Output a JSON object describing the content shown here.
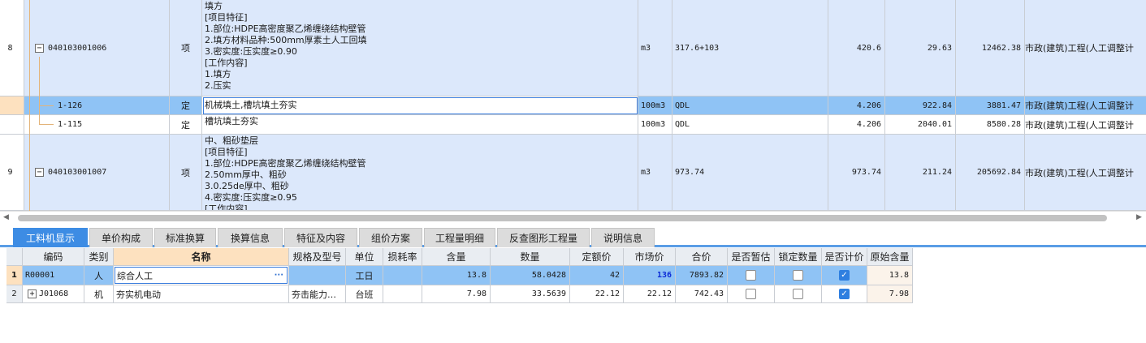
{
  "upper_rows": [
    {
      "row_no": "8",
      "code": "040103001006",
      "kind": "项",
      "description": "填方\n[项目特征]\n1.部位:HDPE高密度聚乙烯缠绕结构壁管\n2.填方材料品种:500mm厚素土人工回填\n3.密实度:压实度≥0.90\n[工作内容]\n1.填方\n2.压实",
      "unit": "m3",
      "expr": "317.6+103",
      "qty": "420.6",
      "price": "29.63",
      "total": "12462.38",
      "specialty": "市政(建筑)工程(人工调整计"
    },
    {
      "row_no": "",
      "code": "1-126",
      "kind": "定",
      "description": "机械填土,槽坑填土夯实",
      "unit": "100m3",
      "expr": "QDL",
      "qty": "4.206",
      "price": "922.84",
      "total": "3881.47",
      "specialty": "市政(建筑)工程(人工调整计"
    },
    {
      "row_no": "",
      "code": "1-115",
      "kind": "定",
      "description": "槽坑填土夯实",
      "unit": "100m3",
      "expr": "QDL",
      "qty": "4.206",
      "price": "2040.01",
      "total": "8580.28",
      "specialty": "市政(建筑)工程(人工调整计"
    },
    {
      "row_no": "9",
      "code": "040103001007",
      "kind": "项",
      "description": "中、粗砂垫层\n[项目特征]\n1.部位:HDPE高密度聚乙烯缠绕结构壁管\n2.50mm厚中、粗砂\n3.0.25de厚中、粗砂\n4.密实度:压实度≥0.95\n[工作内容]",
      "unit": "m3",
      "expr": "973.74",
      "qty": "973.74",
      "price": "211.24",
      "total": "205692.84",
      "specialty": "市政(建筑)工程(人工调整计"
    }
  ],
  "expander_symbol": "−",
  "tabs": [
    "工料机显示",
    "单价构成",
    "标准换算",
    "换算信息",
    "特征及内容",
    "组价方案",
    "工程量明细",
    "反查图形工程量",
    "说明信息"
  ],
  "lower_headers": [
    "编码",
    "类别",
    "名称",
    "规格及型号",
    "单位",
    "损耗率",
    "含量",
    "数量",
    "定额价",
    "市场价",
    "合价",
    "是否暂估",
    "锁定数量",
    "是否计价",
    "原始含量"
  ],
  "lower_rows": [
    {
      "row_no": "1",
      "code": "R00001",
      "category": "人",
      "name": "综合人工",
      "spec": "",
      "unit": "工日",
      "loss": "",
      "content": "13.8",
      "quantity": "58.0428",
      "quota_price": "42",
      "market_price": "136",
      "total": "7893.82",
      "estimated": false,
      "locked": false,
      "priced": true,
      "orig_content": "13.8"
    },
    {
      "row_no": "2",
      "code": "J01068",
      "category": "机",
      "name": "夯实机电动",
      "spec": "夯击能力…",
      "unit": "台班",
      "loss": "",
      "content": "7.98",
      "quantity": "33.5639",
      "quota_price": "22.12",
      "market_price": "22.12",
      "total": "742.43",
      "estimated": false,
      "locked": false,
      "priced": true,
      "orig_content": "7.98"
    }
  ],
  "name_edit_button": "···",
  "expand_plus": "+",
  "checkmark": "✓",
  "colors": {
    "row_blue": "#dce8fb",
    "row_selected": "#8fc3f5",
    "tab_active": "#3d8ce4",
    "header_highlight": "#fde1bf",
    "tree_line": "#e3b47a"
  }
}
